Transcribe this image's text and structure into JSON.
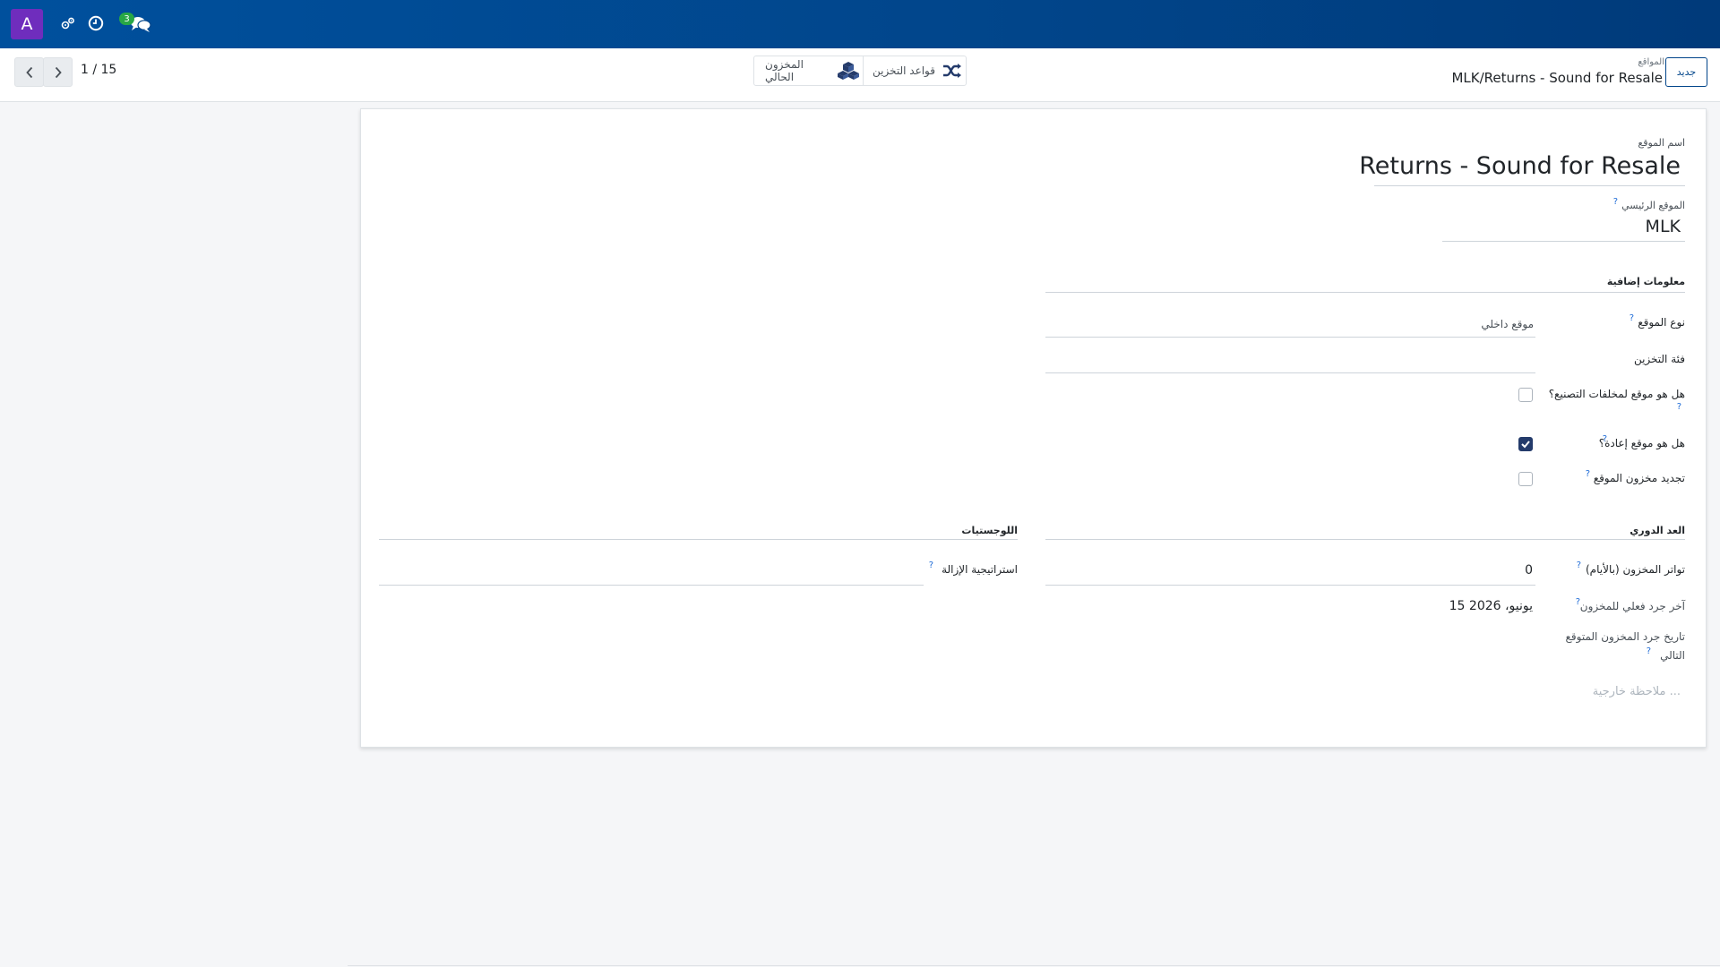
{
  "topbar": {
    "avatar_letter": "A",
    "chat_count": "3",
    "icons": [
      "bugs-icon",
      "clock-icon",
      "chat-icon"
    ]
  },
  "pager": {
    "text": "1 / 15"
  },
  "smart_buttons": [
    {
      "label": "قواعد التخزين",
      "icon": "shuffle-icon"
    },
    {
      "label": "المخزون الحالي",
      "icon": "cubes-icon"
    }
  ],
  "breadcrumb": {
    "parent": "المواقع",
    "current": "MLK/Returns - Sound for Resale",
    "new_label": "جديد"
  },
  "form": {
    "name_label": "اسم الموقع",
    "name_value": "Returns - Sound for Resale",
    "parent_label": "الموقع الرئيسي",
    "parent_value": "MLK",
    "section_additional": "معلومات إضافية",
    "location_type_label": "نوع الموقع",
    "location_type_value": "موقع داخلي",
    "storage_category_label": "فئة التخزين",
    "scrap_label": "هل هو موقع لمخلفات التصنيع؟",
    "scrap_checked": false,
    "return_label": "هل هو موقع إعادة؟",
    "return_checked": true,
    "replenish_label": "تجديد مخزون الموقع",
    "replenish_checked": false,
    "section_cyclic": "العد الدوري",
    "frequency_label": "تواتر المخزون (بالأيام)",
    "frequency_value": "0",
    "last_inventory_label": "آخر جرد فعلي للمخزون",
    "last_inventory_value": "15 يونيو، 2026",
    "next_inventory_label_line1": "تاريخ جرد المخزون المتوقع",
    "next_inventory_label_line2": "التالي",
    "section_logistics": "اللوجستيات",
    "removal_label": "استراتيجية الإزالة",
    "note_placeholder": "ملاحظة خارجية ..."
  },
  "colors": {
    "topbar": "#01458a",
    "avatar": "#6f2dbd",
    "badge": "#28a745",
    "help": "#1e6bd6",
    "checkbox_checked": "#243b6b"
  }
}
